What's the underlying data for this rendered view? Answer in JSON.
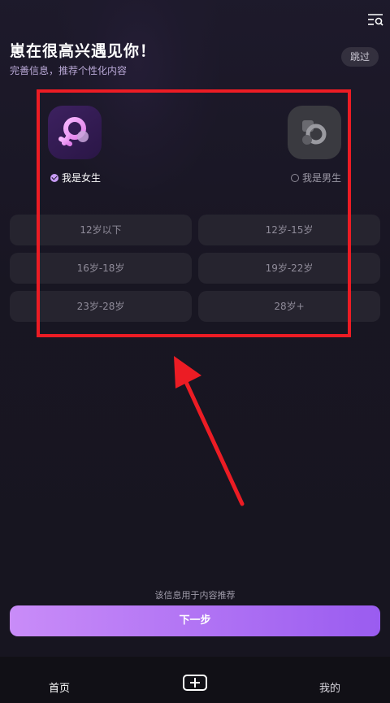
{
  "header": {
    "title": "崽在很高兴遇见你！",
    "subtitle": "完善信息，推荐个性化内容",
    "skip_label": "跳过",
    "menu_icon": "list-search-icon"
  },
  "gender": {
    "female": {
      "label": "我是女生",
      "selected": true,
      "icon": "female-symbol-icon"
    },
    "male": {
      "label": "我是男生",
      "selected": false,
      "icon": "male-symbol-icon"
    }
  },
  "age_options": [
    "12岁以下",
    "12岁-15岁",
    "16岁-18岁",
    "19岁-22岁",
    "23岁-28岁",
    "28岁+"
  ],
  "footer": {
    "hint": "该信息用于内容推荐",
    "next_label": "下一步"
  },
  "tabbar": {
    "home": "首页",
    "create_icon": "plus-box-icon",
    "mine": "我的"
  },
  "colors": {
    "accent": "#c98cf8",
    "accent_end": "#9a5cf0",
    "background": "#171520",
    "annotation": "#ec1c24"
  }
}
